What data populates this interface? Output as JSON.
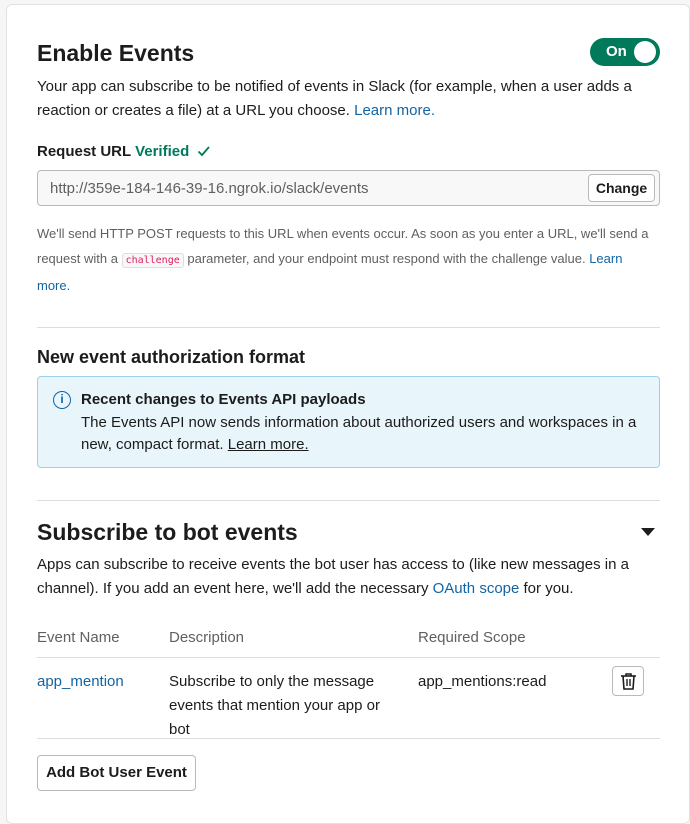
{
  "enable_events": {
    "title": "Enable Events",
    "toggle_label": "On",
    "description": "Your app can subscribe to be notified of events in Slack (for example, when a user adds a reaction or creates a file) at a URL you choose.",
    "learn_more": "Learn more."
  },
  "request_url": {
    "label": "Request URL",
    "status": "Verified",
    "status_icon": "checkmark-icon",
    "value": "http://359e-184-146-39-16.ngrok.io/slack/events",
    "change_label": "Change",
    "help_before": "We'll send HTTP POST requests to this URL when events occur. As soon as you enter a URL, we'll send a request with a",
    "help_code": "challenge",
    "help_after": "parameter, and your endpoint must respond with the challenge value.",
    "learn_more": "Learn more."
  },
  "auth_format": {
    "title": "New event authorization format",
    "banner_title": "Recent changes to Events API payloads",
    "banner_text": "The Events API now sends information about authorized users and workspaces in a new, compact format.",
    "banner_link": "Learn more."
  },
  "bot_events": {
    "title": "Subscribe to bot events",
    "description_before": "Apps can subscribe to receive events the bot user has access to (like new messages in a channel). If you add an event here, we'll add the necessary",
    "oauth_link": "OAuth scope",
    "description_after": "for you.",
    "columns": [
      "Event Name",
      "Description",
      "Required Scope"
    ],
    "rows": [
      {
        "event": "app_mention",
        "description": "Subscribe to only the message events that mention your app or bot",
        "scope": "app_mentions:read"
      }
    ],
    "add_button": "Add Bot User Event"
  },
  "colors": {
    "accent_green": "#007a5a",
    "link_blue": "#1264a3",
    "info_bg": "#e8f5fa"
  }
}
